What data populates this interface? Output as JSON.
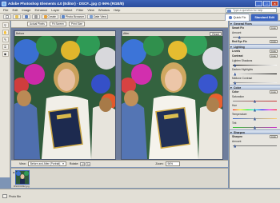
{
  "window": {
    "title": "Adobe Photoshop Elements 4.0 (Editor) - DSCF...jpg @ 96% (RGB/8)"
  },
  "menu": [
    "File",
    "Edit",
    "Image",
    "Enhance",
    "Layer",
    "Select",
    "Filter",
    "View",
    "Window",
    "Help"
  ],
  "search": {
    "placeholder": "Type a question for help"
  },
  "shortcuts": [
    {
      "label": "Create",
      "color": "#e8a23a"
    },
    {
      "label": "Photo Browser",
      "color": "#5b86c9"
    },
    {
      "label": "Date View",
      "color": "#7a9ed2"
    }
  ],
  "modes": {
    "quick": "Quick Fix",
    "standard": "Standard Edit"
  },
  "options": [
    "Actual Pixels",
    "Fit Screen",
    "Print Size"
  ],
  "panes": {
    "before": {
      "label": "Before"
    },
    "after": {
      "label": "After",
      "reset": "Reset"
    }
  },
  "view": {
    "label": "View:",
    "value": "Before and After (Portrait)",
    "rotate_label": "Rotate:",
    "zoom_label": "Zoom:",
    "zoom_value": "96%"
  },
  "panel": {
    "general": {
      "title": "General Fixes",
      "smart_fix": "Smart Fix",
      "auto": "Auto",
      "amount": "Amount",
      "red_eye": "Red Eye Fix",
      "smart_fix_amount": 0.15
    },
    "lighting": {
      "title": "Lighting",
      "levels": "Levels",
      "contrast": "Contrast",
      "lighten_shadows": "Lighten Shadows",
      "darken_highlights": "Darken Highlights",
      "midtone_contrast": "Midtone Contrast",
      "lighten_shadows_value": 0.05,
      "darken_highlights_value": 0.05,
      "midtone_contrast_value": 0.05
    },
    "color": {
      "title": "Color",
      "color": "Color",
      "saturation": "Saturation",
      "hue": "Hue",
      "temperature": "Temperature",
      "tint": "Tint",
      "saturation_value": 0.5,
      "hue_value": 0.5,
      "temperature_value": 0.5,
      "tint_value": 0.5
    },
    "sharpen": {
      "title": "Sharpen",
      "sharpen": "Sharpen",
      "amount": "Amount",
      "amount_value": 0.05
    }
  },
  "filmstrip": {
    "thumb_name": "DSCF0032.jpg"
  },
  "status": {
    "taskbar": "Photo Bin"
  }
}
